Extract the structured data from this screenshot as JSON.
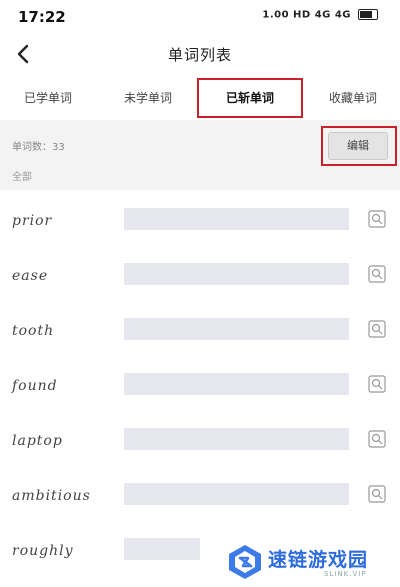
{
  "status_bar": {
    "time": "17:22",
    "indicators": "1.00 HD 4G 4G"
  },
  "header": {
    "title": "单词列表"
  },
  "tabs": [
    {
      "label": "已学单词",
      "active": false
    },
    {
      "label": "未学单词",
      "active": false
    },
    {
      "label": "已斩单词",
      "active": true
    },
    {
      "label": "收藏单词",
      "active": false
    }
  ],
  "info": {
    "word_count": "单词数：33",
    "filter_label": "全部",
    "edit_label": "编辑"
  },
  "words": [
    {
      "word": "prior"
    },
    {
      "word": "ease"
    },
    {
      "word": "tooth"
    },
    {
      "word": "found"
    },
    {
      "word": "laptop"
    },
    {
      "word": "ambitious"
    },
    {
      "word": "roughly"
    }
  ],
  "watermark": {
    "text": "速链游戏园",
    "sub": "SLINK.VIP"
  },
  "colors": {
    "highlight": "#c8232c",
    "meaning_bar": "#e6e6ee",
    "brand": "#2d6cdf"
  }
}
